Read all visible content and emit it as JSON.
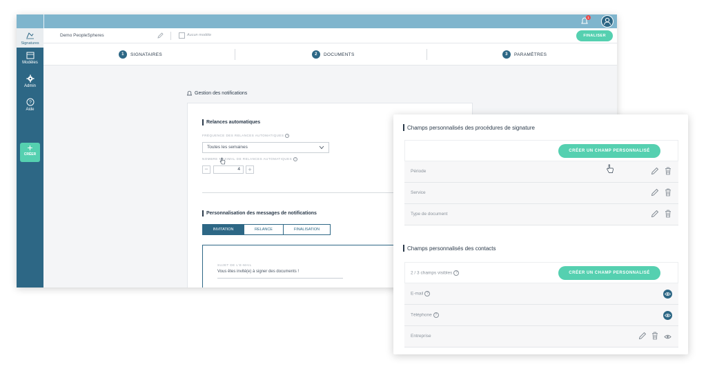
{
  "header": {
    "workspace_name": "Demo PeopleSpheres",
    "template_placeholder": "Aucun modèle",
    "finalize_label": "FINALISER",
    "notification_badge": "1"
  },
  "sidebar": {
    "items": [
      {
        "label": "Signatures",
        "icon": "signature-icon"
      },
      {
        "label": "Modèles",
        "icon": "template-icon"
      },
      {
        "label": "Admin",
        "icon": "gear-icon"
      },
      {
        "label": "Aide",
        "icon": "help-icon"
      }
    ],
    "create_label": "CRÉER"
  },
  "steps": [
    {
      "num": "1",
      "label": "SIGNATAIRES"
    },
    {
      "num": "2",
      "label": "DOCUMENTS"
    },
    {
      "num": "3",
      "label": "PARAMÈTRES"
    }
  ],
  "notifications": {
    "title": "Gestion des notifications",
    "auto_reminders": {
      "title": "Relances automatiques",
      "frequency_label": "FRÉQUENCE DES RELANCES AUTOMATIQUES",
      "frequency_value": "Toutes les semaines",
      "max_label": "NOMBRE MAXIMAL DE RELANCES AUTOMATIQUES",
      "max_value": "4"
    },
    "messages": {
      "title": "Personnalisation des messages de notifications",
      "tabs": [
        "INVITATION",
        "RELANCE",
        "FINALISATION"
      ],
      "subject_label": "SUJET DE L'E-MAIL",
      "subject_value": "Vous êtes invité(e) à signer des documents !"
    }
  },
  "panel": {
    "procedures": {
      "title": "Champs personnalisés des procédures de signature",
      "create_label": "CRÉER UN CHAMP PERSONNALISÉ",
      "rows": [
        "Période",
        "Service",
        "Type de document"
      ]
    },
    "contacts": {
      "title": "Champs personnalisés des contacts",
      "visible_count": "2 / 3 champs visibles",
      "create_label": "CRÉER UN CHAMP PERSONNALISÉ",
      "rows": [
        "E-mail",
        "Téléphone",
        "Entreprise"
      ]
    }
  },
  "colors": {
    "primary": "#2d6785",
    "accent": "#55d0b0",
    "topbar": "#7fb5cd"
  }
}
